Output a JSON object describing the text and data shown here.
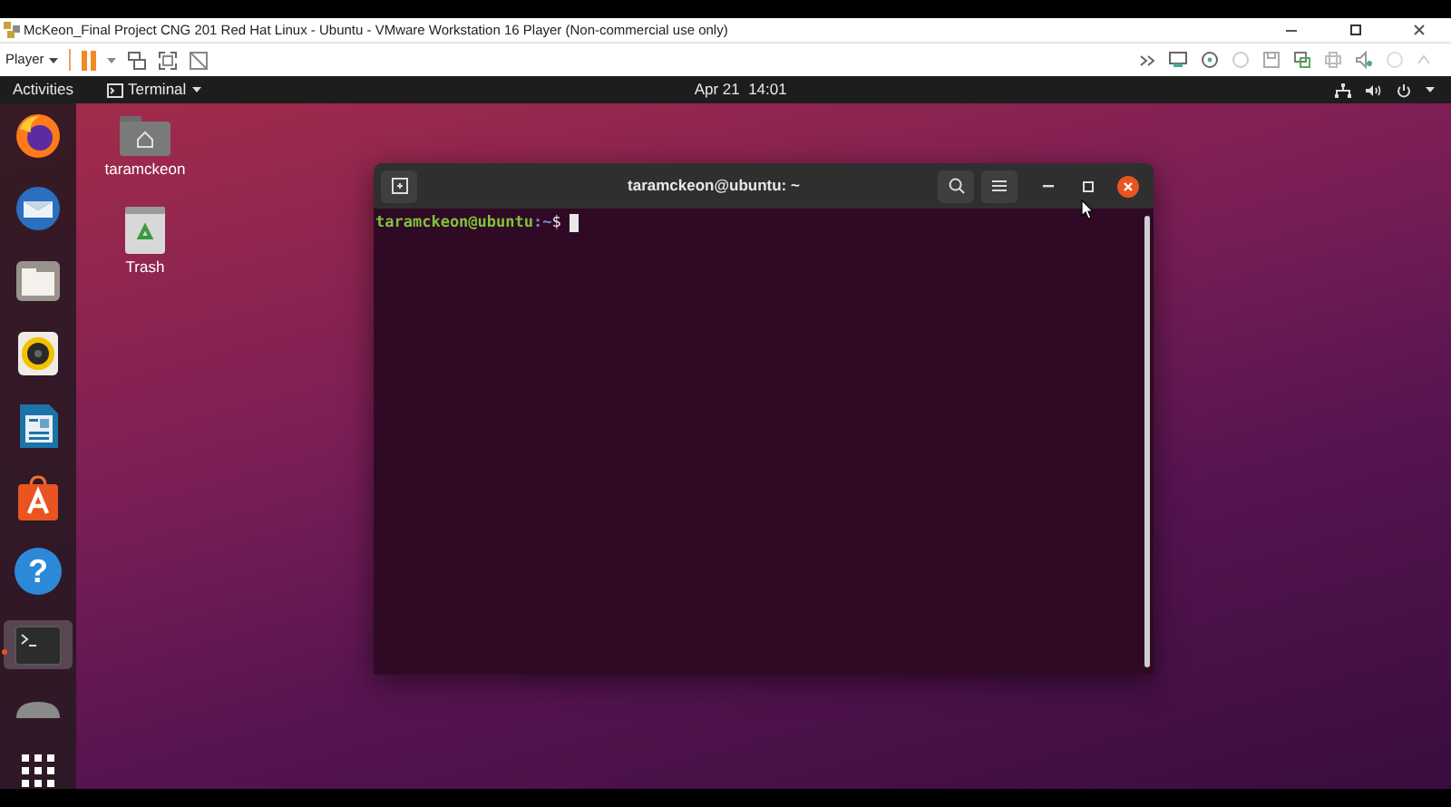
{
  "vm_window": {
    "title": "McKeon_Final Project CNG 201 Red Hat Linux - Ubuntu - VMware Workstation 16 Player (Non-commercial use only)",
    "player_menu": "Player",
    "paused": false
  },
  "top_bar": {
    "activities": "Activities",
    "app_menu": "Terminal",
    "clock": "Apr 21  14:01"
  },
  "dock": [
    {
      "kind": "firefox",
      "running": false
    },
    {
      "kind": "mail",
      "running": false
    },
    {
      "kind": "files",
      "running": false
    },
    {
      "kind": "music",
      "running": false
    },
    {
      "kind": "writer",
      "running": false
    },
    {
      "kind": "software",
      "running": false
    },
    {
      "kind": "help",
      "glyph": "?",
      "running": false
    },
    {
      "kind": "terminal",
      "running": true
    },
    {
      "kind": "partial",
      "running": false
    },
    {
      "kind": "apps",
      "running": false
    }
  ],
  "desktop_icons": [
    {
      "kind": "home",
      "label": "taramckeon"
    },
    {
      "kind": "trash",
      "label": "Trash"
    }
  ],
  "terminal": {
    "title": "taramckeon@ubuntu: ~",
    "prompt_user": "taramckeon@ubuntu",
    "prompt_path": ":~",
    "prompt_symbol": "$"
  }
}
